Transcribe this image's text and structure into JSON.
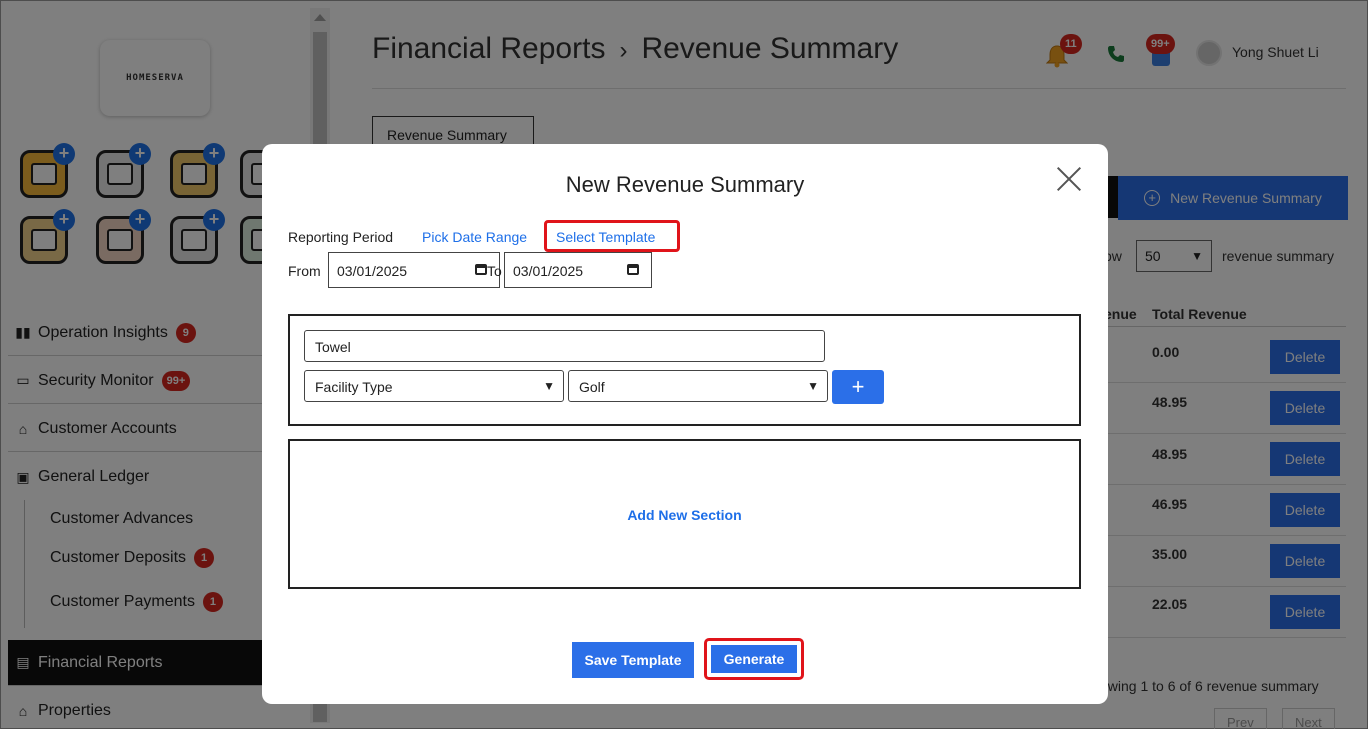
{
  "sidebar": {
    "logo_text": "HOMESERVA",
    "nav": [
      {
        "label": "Operation Insights",
        "badge": "9"
      },
      {
        "label": "Security Monitor",
        "badge": "99+"
      },
      {
        "label": "Customer Accounts",
        "badge": ""
      },
      {
        "label": "General Ledger",
        "badge": ""
      }
    ],
    "ledger_items": [
      {
        "label": "Customer Advances",
        "badge": ""
      },
      {
        "label": "Customer Deposits",
        "badge": "1"
      },
      {
        "label": "Customer Payments",
        "badge": "1"
      }
    ],
    "active_item": "Financial Reports",
    "properties": "Properties"
  },
  "header": {
    "breadcrumb_parent": "Financial Reports",
    "breadcrumb_sep": "›",
    "breadcrumb_current": "Revenue Summary",
    "notifications_badge": "11",
    "messages_badge": "99+",
    "user_name": "Yong Shuet Li"
  },
  "page": {
    "tab_label": "Revenue Summary",
    "new_button": "New Revenue Summary",
    "show_prefix": "ow",
    "show_value": "50",
    "show_suffix": "revenue summary",
    "col_partial": "enue",
    "col_total": "Total Revenue",
    "rows": [
      "0.00",
      "48.95",
      "48.95",
      "46.95",
      "35.00",
      "22.05"
    ],
    "delete_label": "Delete",
    "showing_text": "owing 1 to 6 of 6 revenue summary",
    "prev": "Prev",
    "next": "Next"
  },
  "modal": {
    "title": "New Revenue Summary",
    "reporting_period_label": "Reporting Period",
    "pick_date_range": "Pick Date Range",
    "select_template": "Select Template",
    "from_label": "From",
    "from_value": "03/01/2025",
    "to_label": "To",
    "to_value": "03/01/2025",
    "section_name": "Towel",
    "filter_type": "Facility Type",
    "filter_value": "Golf",
    "add_button": "+",
    "add_new_section": "Add New Section",
    "save_template": "Save Template",
    "generate": "Generate"
  },
  "colors": {
    "primary": "#2b6fe8",
    "highlight": "#e0141a",
    "badge": "#d7261e"
  }
}
